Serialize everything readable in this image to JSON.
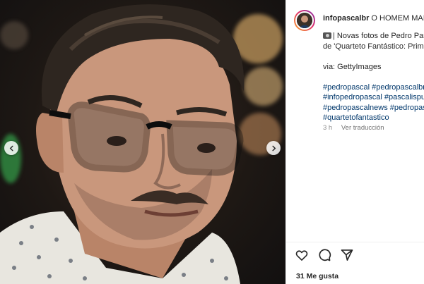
{
  "post": {
    "username": "infopascalbr",
    "header_title": "O HOMEM MAIS",
    "caption_lines": [
      "| Novas fotos de Pedro Pascal",
      "de 'Quarteto Fantástico: Prime"
    ],
    "via": "via: GettyImages",
    "hashtag_lines": [
      "#pedropascal #pedropascalbra",
      "#infopedropascal #pascalispur",
      "#pedropascalnews #pedropas",
      "#quartetofantastico"
    ],
    "time_ago": "3 h",
    "translate_label": "Ver traducción",
    "likes": "31 Me gusta"
  },
  "icons": {
    "caption_emoji": "camera-icon",
    "nav_left": "chevron-left-icon",
    "nav_right": "chevron-right-icon",
    "like": "heart-icon",
    "comment": "comment-icon",
    "share": "send-icon"
  },
  "colors": {
    "hashtag": "#00376b",
    "muted": "#8e8e8e",
    "text": "#262626"
  }
}
